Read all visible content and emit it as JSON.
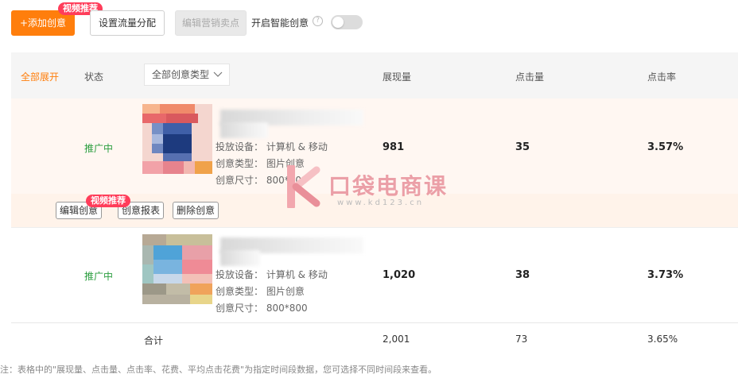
{
  "toolbar": {
    "add_label": "+添加创意",
    "video_tag": "视频推荐",
    "flow_label": "设置流量分配",
    "edit_selling_label": "编辑营销卖点",
    "smart_label": "开启智能创意",
    "help_glyph": "?",
    "smart_enabled": false
  },
  "table": {
    "headers": {
      "expand": "全部展开",
      "status": "状态",
      "type_select": "全部创意类型",
      "impressions": "展现量",
      "clicks": "点击量",
      "ctr": "点击率"
    },
    "rows": [
      {
        "status": "推广中",
        "device_label": "投放设备：",
        "device": "计算机 & 移动",
        "type_label": "创意类型：",
        "type": "图片创意",
        "size_label": "创意尺寸：",
        "size": "800*800",
        "impressions": "981",
        "clicks": "35",
        "ctr": "3.57%"
      },
      {
        "status": "推广中",
        "device_label": "投放设备：",
        "device": "计算机 & 移动",
        "type_label": "创意类型：",
        "type": "图片创意",
        "size_label": "创意尺寸：",
        "size": "800*800",
        "impressions": "1,020",
        "clicks": "38",
        "ctr": "3.73%"
      }
    ],
    "actions": {
      "edit": "编辑创意",
      "report": "创意报表",
      "delete": "删除创意",
      "video_tag": "视频推荐"
    },
    "total": {
      "label": "合计",
      "impressions": "2,001",
      "clicks": "73",
      "ctr": "3.65%"
    }
  },
  "note": "注：表格中的\"展现量、点击量、点击率、花费、平均点击花费\"为指定时间段数据，您可选择不同时间段来查看。",
  "watermark": {
    "text": "口袋电商课",
    "url": "www.kd123.cn"
  },
  "colors": {
    "accent": "#ff7e0c",
    "tag": "#ff3d5a",
    "status_green": "#2a9d3e"
  }
}
